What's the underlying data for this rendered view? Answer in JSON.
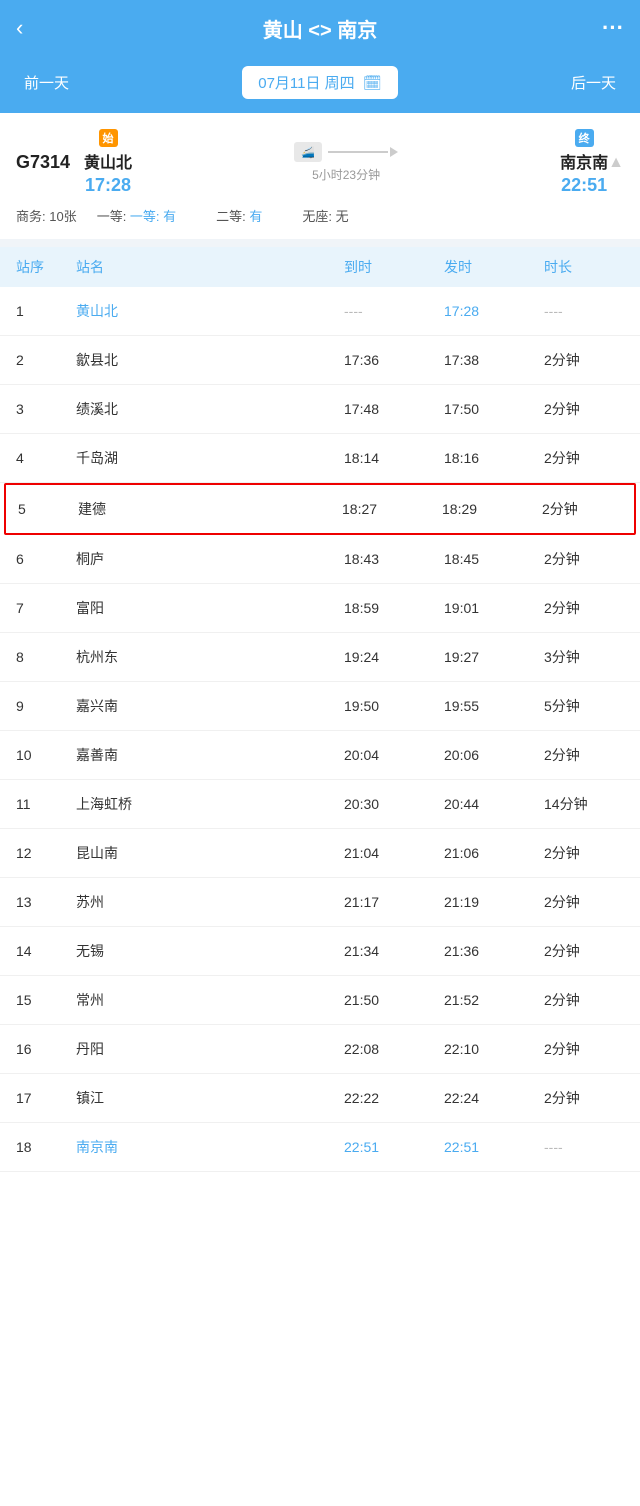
{
  "header": {
    "back_label": "‹",
    "title": "黄山 <> 南京",
    "more_label": "···"
  },
  "date_nav": {
    "prev_label": "前一天",
    "next_label": "后一天",
    "date_display": "07月11日 周四",
    "calendar_icon": "📅"
  },
  "train": {
    "number": "G7314",
    "from": {
      "tag": "始",
      "name": "黄山北",
      "time": "17:28"
    },
    "duration": "5小时23分钟",
    "to": {
      "tag": "终",
      "name": "南京南",
      "time": "22:51"
    },
    "seats": {
      "business": "商务: 10张",
      "first": "一等: 有",
      "second": "二等: 有",
      "no_seat": "无座: 无"
    }
  },
  "table": {
    "headers": [
      "站序",
      "站名",
      "到时",
      "发时",
      "时长"
    ],
    "rows": [
      {
        "seq": "1",
        "name": "黄山北",
        "arrive": "----",
        "depart": "17:28",
        "duration": "----",
        "first": true,
        "highlighted": false
      },
      {
        "seq": "2",
        "name": "歙县北",
        "arrive": "17:36",
        "depart": "17:38",
        "duration": "2分钟",
        "first": false,
        "highlighted": false
      },
      {
        "seq": "3",
        "name": "绩溪北",
        "arrive": "17:48",
        "depart": "17:50",
        "duration": "2分钟",
        "first": false,
        "highlighted": false
      },
      {
        "seq": "4",
        "name": "千岛湖",
        "arrive": "18:14",
        "depart": "18:16",
        "duration": "2分钟",
        "first": false,
        "highlighted": false
      },
      {
        "seq": "5",
        "name": "建德",
        "arrive": "18:27",
        "depart": "18:29",
        "duration": "2分钟",
        "first": false,
        "highlighted": true
      },
      {
        "seq": "6",
        "name": "桐庐",
        "arrive": "18:43",
        "depart": "18:45",
        "duration": "2分钟",
        "first": false,
        "highlighted": false
      },
      {
        "seq": "7",
        "name": "富阳",
        "arrive": "18:59",
        "depart": "19:01",
        "duration": "2分钟",
        "first": false,
        "highlighted": false
      },
      {
        "seq": "8",
        "name": "杭州东",
        "arrive": "19:24",
        "depart": "19:27",
        "duration": "3分钟",
        "first": false,
        "highlighted": false
      },
      {
        "seq": "9",
        "name": "嘉兴南",
        "arrive": "19:50",
        "depart": "19:55",
        "duration": "5分钟",
        "first": false,
        "highlighted": false
      },
      {
        "seq": "10",
        "name": "嘉善南",
        "arrive": "20:04",
        "depart": "20:06",
        "duration": "2分钟",
        "first": false,
        "highlighted": false
      },
      {
        "seq": "11",
        "name": "上海虹桥",
        "arrive": "20:30",
        "depart": "20:44",
        "duration": "14分钟",
        "first": false,
        "highlighted": false
      },
      {
        "seq": "12",
        "name": "昆山南",
        "arrive": "21:04",
        "depart": "21:06",
        "duration": "2分钟",
        "first": false,
        "highlighted": false
      },
      {
        "seq": "13",
        "name": "苏州",
        "arrive": "21:17",
        "depart": "21:19",
        "duration": "2分钟",
        "first": false,
        "highlighted": false
      },
      {
        "seq": "14",
        "name": "无锡",
        "arrive": "21:34",
        "depart": "21:36",
        "duration": "2分钟",
        "first": false,
        "highlighted": false
      },
      {
        "seq": "15",
        "name": "常州",
        "arrive": "21:50",
        "depart": "21:52",
        "duration": "2分钟",
        "first": false,
        "highlighted": false
      },
      {
        "seq": "16",
        "name": "丹阳",
        "arrive": "22:08",
        "depart": "22:10",
        "duration": "2分钟",
        "first": false,
        "highlighted": false
      },
      {
        "seq": "17",
        "name": "镇江",
        "arrive": "22:22",
        "depart": "22:24",
        "duration": "2分钟",
        "first": false,
        "highlighted": false
      },
      {
        "seq": "18",
        "name": "南京南",
        "arrive": "22:51",
        "depart": "22:51",
        "duration": "----",
        "first": false,
        "highlighted": false,
        "last": true
      }
    ]
  }
}
